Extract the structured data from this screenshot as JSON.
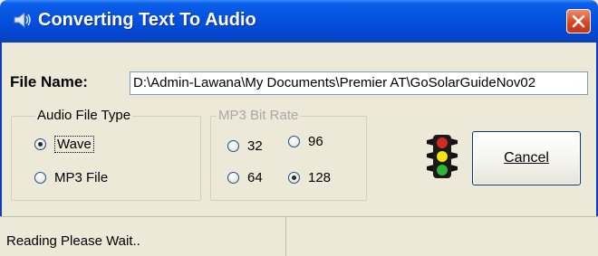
{
  "window": {
    "title": "Converting Text To Audio"
  },
  "file": {
    "label": "File Name:",
    "value": "D:\\Admin-Lawana\\My Documents\\Premier AT\\GoSolarGuideNov02"
  },
  "audio_file_type": {
    "title": "Audio File Type",
    "options": [
      {
        "label": "Wave",
        "checked": true
      },
      {
        "label": "MP3 File",
        "checked": false
      }
    ]
  },
  "mp3_bit_rate": {
    "title": "MP3 Bit Rate",
    "options": [
      {
        "label": "32",
        "checked": false
      },
      {
        "label": "96",
        "checked": false
      },
      {
        "label": "64",
        "checked": false
      },
      {
        "label": "128",
        "checked": true
      }
    ]
  },
  "buttons": {
    "cancel": "Cancel"
  },
  "status": {
    "text": "Reading Please Wait.."
  },
  "icons": {
    "app": "speaker-icon",
    "close": "close-icon",
    "traffic": "traffic-light-icon"
  },
  "colors": {
    "titlebar": "#0551DF",
    "close": "#D9471F",
    "dialog": "#ECE9D8"
  }
}
